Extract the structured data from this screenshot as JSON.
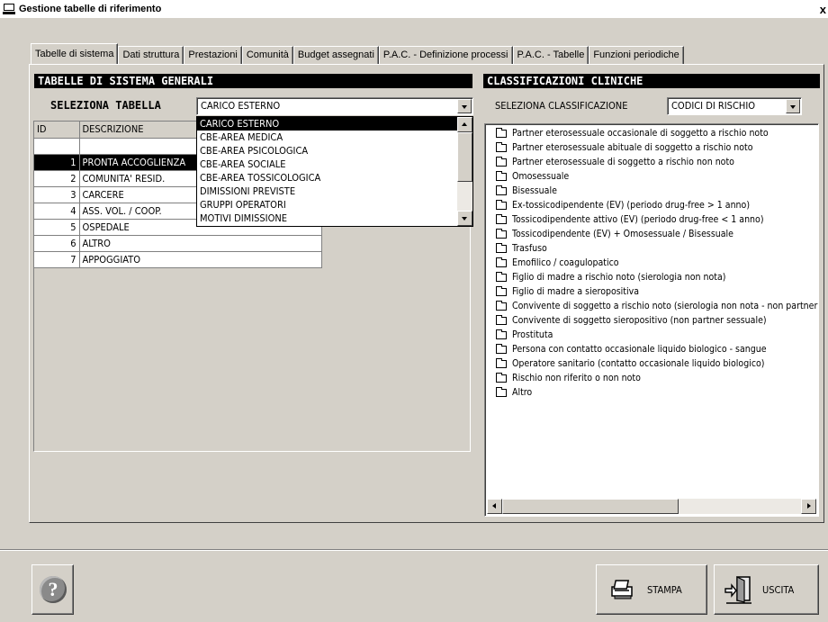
{
  "window": {
    "title": "Gestione tabelle di riferimento",
    "close": "x"
  },
  "tabs": [
    {
      "label": "Tabelle di sistema",
      "active": true
    },
    {
      "label": "Dati struttura"
    },
    {
      "label": "Prestazioni"
    },
    {
      "label": "Comunità"
    },
    {
      "label": "Budget assegnati"
    },
    {
      "label": "P.A.C. - Definizione processi"
    },
    {
      "label": "P.A.C. - Tabelle"
    },
    {
      "label": "Funzioni periodiche"
    }
  ],
  "left_panel": {
    "header": "TABELLE DI SISTEMA GENERALI",
    "select_label": "SELEZIONA TABELLA",
    "select_value": "CARICO ESTERNO",
    "dropdown_options": [
      "CARICO ESTERNO",
      "CBE-AREA MEDICA",
      "CBE-AREA PSICOLOGICA",
      "CBE-AREA SOCIALE",
      "CBE-AREA TOSSICOLOGICA",
      "DIMISSIONI PREVISTE",
      "GRUPPI OPERATORI",
      "MOTIVI DIMISSIONE"
    ],
    "grid": {
      "columns": [
        "ID",
        "DESCRIZIONE"
      ],
      "rows": [
        {
          "id": "1",
          "desc": "PRONTA ACCOGLIENZA",
          "selected": true
        },
        {
          "id": "2",
          "desc": "COMUNITA' RESID."
        },
        {
          "id": "3",
          "desc": "CARCERE"
        },
        {
          "id": "4",
          "desc": "ASS. VOL. / COOP."
        },
        {
          "id": "5",
          "desc": "OSPEDALE"
        },
        {
          "id": "6",
          "desc": "ALTRO"
        },
        {
          "id": "7",
          "desc": "APPOGGIATO"
        }
      ]
    }
  },
  "right_panel": {
    "header": "CLASSIFICAZIONI CLINICHE",
    "select_label": "SELEZIONA CLASSIFICAZIONE",
    "select_value": "CODICI DI RISCHIO",
    "tree_items": [
      "Partner eterosessuale occasionale di soggetto a rischio noto",
      "Partner eterosessuale abituale di soggetto a rischio noto",
      "Partner eterosessuale di soggetto a rischio non noto",
      "Omosessuale",
      "Bisessuale",
      "Ex-tossicodipendente (EV) (periodo drug-free > 1 anno)",
      "Tossicodipendente attivo (EV) (periodo drug-free < 1 anno)",
      "Tossicodipendente (EV) + Omosessuale / Bisessuale",
      "Trasfuso",
      "Emofilico / coagulopatico",
      "Figlio di madre a rischio noto (sierologia non nota)",
      "Figlio di madre a sieropositiva",
      "Convivente di soggetto a rischio noto (sierologia non nota - non partner)",
      "Convivente di soggetto sieropositivo (non partner sessuale)",
      "Prostituta",
      "Persona con contatto occasionale liquido biologico - sangue",
      "Operatore sanitario (contatto occasionale liquido biologico)",
      "Rischio non riferito o non noto",
      "Altro"
    ]
  },
  "buttons": {
    "help_icon_text": "?",
    "print": "STAMPA",
    "exit": "USCITA"
  }
}
